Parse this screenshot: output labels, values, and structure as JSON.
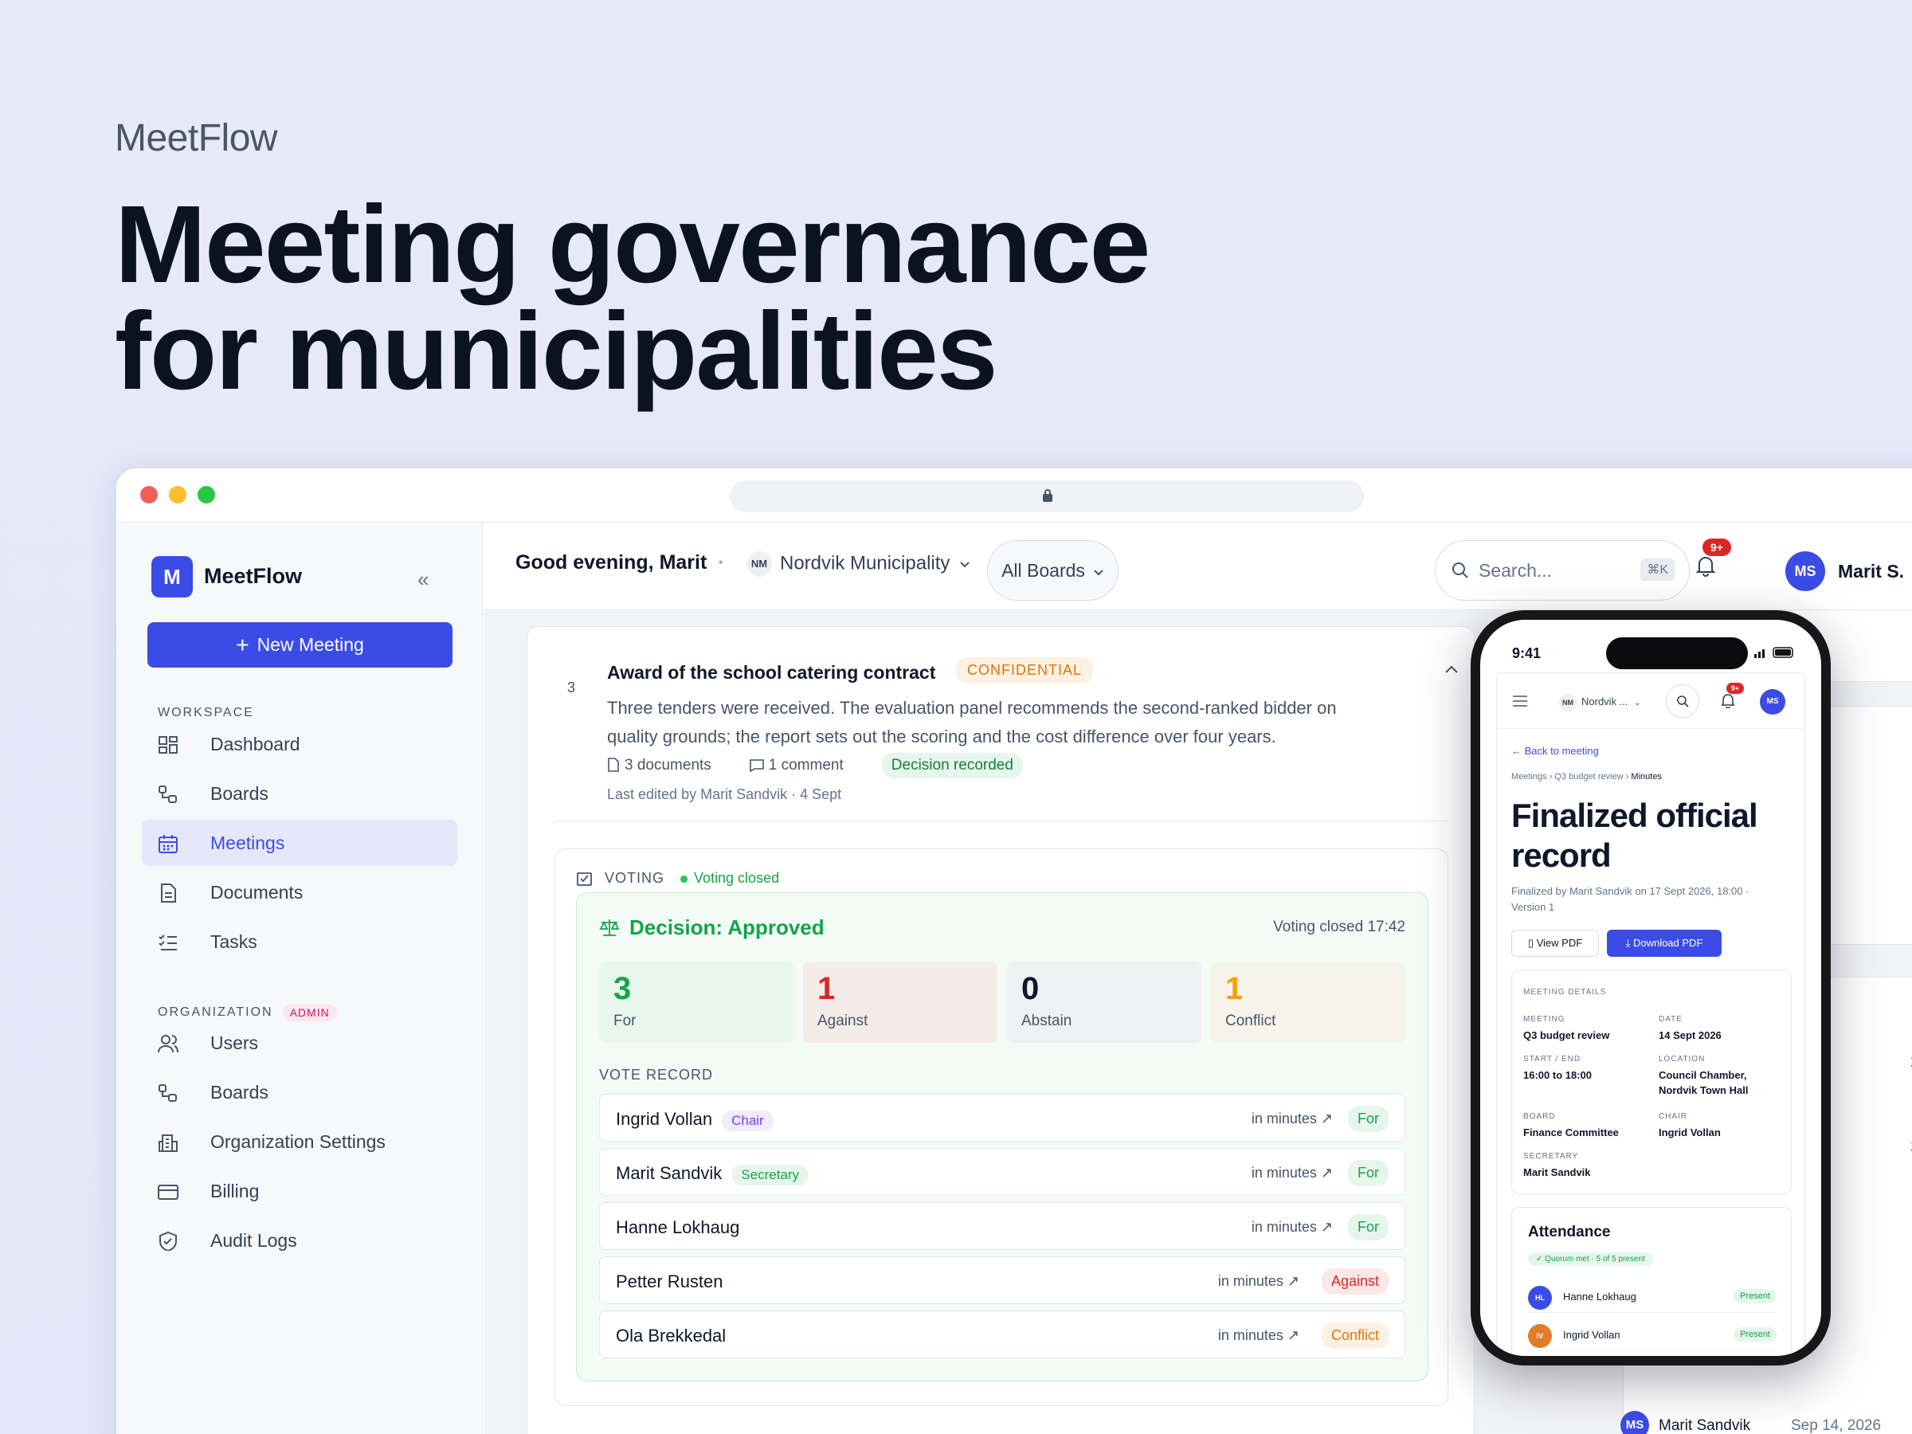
{
  "hero": {
    "brand": "MeetFlow",
    "headline_line1": "Meeting governance",
    "headline_line2": "for municipalities"
  },
  "sidebar": {
    "logo_letter": "M",
    "app_name": "MeetFlow",
    "collapse_glyph": "«",
    "new_meeting": "New Meeting",
    "workspace_label": "WORKSPACE",
    "workspace_items": [
      {
        "label": "Dashboard",
        "icon": "grid-icon"
      },
      {
        "label": "Boards",
        "icon": "boards-icon"
      },
      {
        "label": "Meetings",
        "icon": "calendar-icon",
        "active": true
      },
      {
        "label": "Documents",
        "icon": "document-icon"
      },
      {
        "label": "Tasks",
        "icon": "checklist-icon"
      }
    ],
    "org_label": "ORGANIZATION",
    "admin_badge": "ADMIN",
    "org_items": [
      {
        "label": "Users",
        "icon": "users-icon"
      },
      {
        "label": "Boards",
        "icon": "boards-icon"
      },
      {
        "label": "Organization Settings",
        "icon": "building-icon"
      },
      {
        "label": "Billing",
        "icon": "card-icon"
      },
      {
        "label": "Audit Logs",
        "icon": "shield-icon"
      }
    ]
  },
  "topbar": {
    "greeting": "Good evening, Marit",
    "separator": "·",
    "org_initials": "NM",
    "org_name": "Nordvik Municipality",
    "boards_filter": "All Boards",
    "search_placeholder": "Search...",
    "search_shortcut": "⌘K",
    "notification_count": "9+",
    "user_initials": "MS",
    "user_name": "Marit S."
  },
  "agenda_item": {
    "number": "3",
    "title": "Award of the school catering contract",
    "badge": "CONFIDENTIAL",
    "description": "Three tenders were received. The evaluation panel recommends the second-ranked bidder on quality grounds; the report sets out the scoring and the cost difference over four years.",
    "documents": "3 documents",
    "comments": "1 comment",
    "status": "Decision recorded",
    "edited": "Last edited by Marit Sandvik · 4 Sept"
  },
  "voting": {
    "label": "VOTING",
    "status": "Voting closed",
    "decision": "Decision: Approved",
    "closed_time": "Voting closed 17:42",
    "tallies": [
      {
        "count": "3",
        "label": "For",
        "color": "#16a34a",
        "bg": "#e8f7ee"
      },
      {
        "count": "1",
        "label": "Against",
        "color": "#dc2626",
        "bg": "#f5ece8"
      },
      {
        "count": "0",
        "label": "Abstain",
        "color": "#0f172a",
        "bg": "#eef0f2"
      },
      {
        "count": "1",
        "label": "Conflict",
        "color": "#f59e0b",
        "bg": "#f6f3ea"
      }
    ],
    "record_label": "VOTE RECORD",
    "records": [
      {
        "name": "Ingrid Vollan",
        "role": "Chair",
        "minutes": "in minutes",
        "vote": "For"
      },
      {
        "name": "Marit Sandvik",
        "role": "Secretary",
        "minutes": "in minutes",
        "vote": "For"
      },
      {
        "name": "Hanne Lokhaug",
        "role": "",
        "minutes": "in minutes",
        "vote": "For"
      },
      {
        "name": "Petter Rusten",
        "role": "",
        "minutes": "in minutes",
        "vote": "Against"
      },
      {
        "name": "Ola Brekkedal",
        "role": "",
        "minutes": "in minutes",
        "vote": "Conflict"
      }
    ]
  },
  "background_panel": {
    "fragment_1": "26",
    "fragment_2": "26",
    "fragment_3": "e",
    "author_initials": "MS",
    "author": "Marit Sandvik",
    "date": "Sep 14, 2026"
  },
  "phone": {
    "time": "9:41",
    "org_initials": "NM",
    "org_name": "Nordvik ...",
    "notif": "9+",
    "user_initials": "MS",
    "back": "Back to meeting",
    "crumbs": [
      "Meetings",
      "Q3 budget review",
      "Minutes"
    ],
    "title_line1": "Finalized official",
    "title_line2": "record",
    "finalized": "Finalized by Marit Sandvik on 17 Sept 2026, 18:00 · Version 1",
    "view_pdf": "View PDF",
    "download_pdf": "Download PDF",
    "details_label": "MEETING DETAILS",
    "details": {
      "meeting_label": "MEETING",
      "meeting": "Q3 budget review",
      "date_label": "DATE",
      "date": "14 Sept 2026",
      "time_label": "START / END",
      "time": "16:00 to 18:00",
      "location_label": "LOCATION",
      "location": "Council Chamber, Nordvik Town Hall",
      "board_label": "BOARD",
      "board": "Finance Committee",
      "chair_label": "CHAIR",
      "chair": "Ingrid Vollan",
      "secretary_label": "SECRETARY",
      "secretary": "Marit Sandvik"
    },
    "attendance_title": "Attendance",
    "quorum": "Quorum met · 5 of 5 present",
    "attendees": [
      {
        "initials": "HL",
        "name": "Hanne Lokhaug",
        "status": "Present",
        "color": "#3b4ce6"
      },
      {
        "initials": "IV",
        "name": "Ingrid Vollan",
        "status": "Present",
        "color": "#e07b2a"
      }
    ]
  }
}
